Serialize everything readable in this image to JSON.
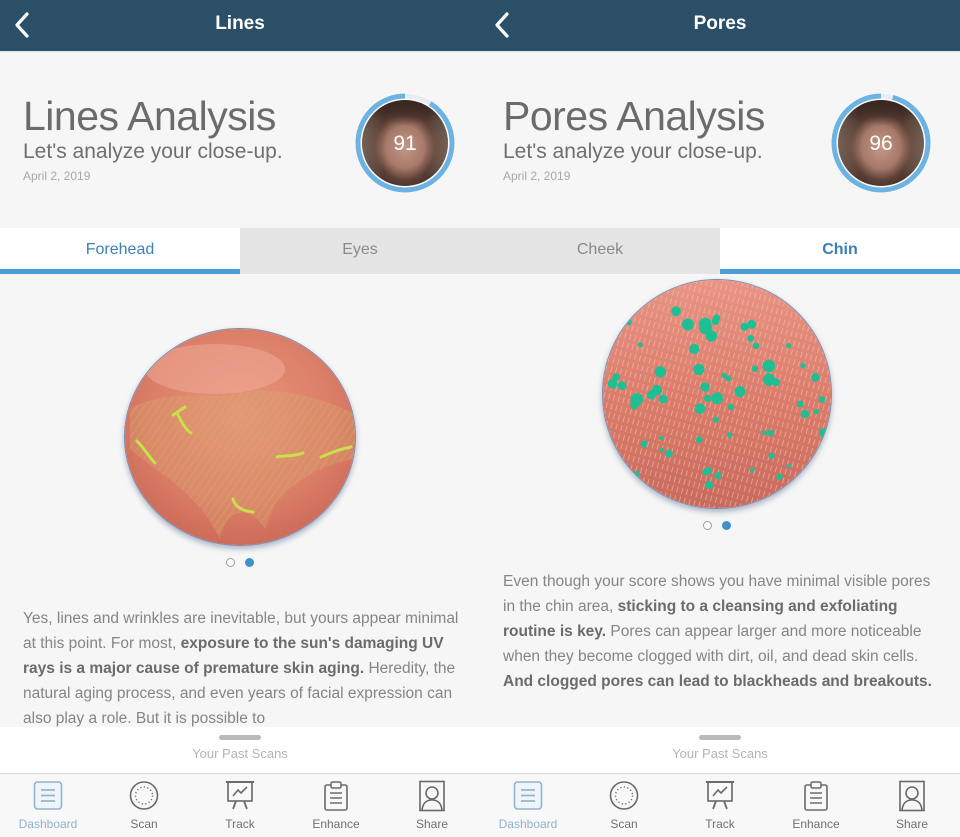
{
  "panels": [
    {
      "nav_title": "Lines",
      "analysis_title": "Lines Analysis",
      "subtitle": "Let's analyze your close-up.",
      "date": "April 2, 2019",
      "score": "91",
      "score_fraction": 0.91,
      "tabs": [
        {
          "label": "Forehead",
          "active": true
        },
        {
          "label": "Eyes",
          "active": false
        }
      ],
      "carousel": {
        "pages": 2,
        "current": 2
      },
      "body": {
        "p1": "Yes, lines and wrinkles are inevitable, but yours appear minimal at this point. For most, ",
        "b1": "exposure to the sun's damaging UV rays is a major cause of premature skin aging.",
        "p2": " Heredity, the natural aging process, and even years of facial expression can also play a role. But it is possible to"
      }
    },
    {
      "nav_title": "Pores",
      "analysis_title": "Pores Analysis",
      "subtitle": "Let's analyze your close-up.",
      "date": "April 2, 2019",
      "score": "96",
      "score_fraction": 0.96,
      "tabs": [
        {
          "label": "Cheek",
          "active": false
        },
        {
          "label": "Chin",
          "active": true
        }
      ],
      "carousel": {
        "pages": 2,
        "current": 2
      },
      "body": {
        "p1": "Even though your score shows you have minimal visible pores in the chin area, ",
        "b1": "sticking to a cleansing and exfoliating routine is key.",
        "p2": " Pores can appear larger and more noticeable when they become clogged with dirt, oil, and dead skin cells. ",
        "b2": "And clogged pores can lead to blackheads and breakouts."
      }
    }
  ],
  "sheet_label": "Your Past Scans",
  "tabbar": [
    {
      "label": "Dashboard",
      "icon": "dashboard-icon",
      "active": true
    },
    {
      "label": "Scan",
      "icon": "scan-icon",
      "active": false
    },
    {
      "label": "Track",
      "icon": "track-icon",
      "active": false
    },
    {
      "label": "Enhance",
      "icon": "enhance-icon",
      "active": false
    },
    {
      "label": "Share",
      "icon": "share-icon",
      "active": false
    }
  ],
  "colors": {
    "nav_bar": "#2b4f66",
    "accent": "#4a9ed6",
    "score_ring": "#6cb3e3",
    "pore_marker": "#1fbf94",
    "line_marker": "#c8e04a"
  }
}
